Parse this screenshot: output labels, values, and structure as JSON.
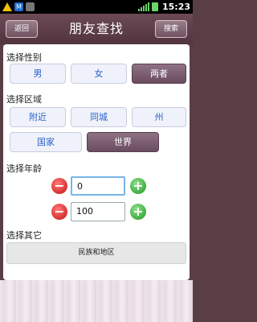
{
  "status_bar": {
    "time": "15:23",
    "notification_icon": "M"
  },
  "header": {
    "back_label": "返回",
    "title": "朋友查找",
    "search_label": "搜索"
  },
  "gender": {
    "label": "选择性别",
    "options": [
      "男",
      "女",
      "两者"
    ],
    "selected": "两者"
  },
  "region": {
    "label": "选择区域",
    "options": [
      "附近",
      "同城",
      "州",
      "国家",
      "世界"
    ],
    "selected": "世界"
  },
  "age": {
    "label": "选择年龄",
    "min_value": "0",
    "max_value": "100"
  },
  "other": {
    "label": "选择其它",
    "button_label": "民族和地区"
  },
  "colors": {
    "header": "#5c3f4a",
    "selected_option": "#7a5b6e",
    "option_text": "#2c62c9"
  }
}
